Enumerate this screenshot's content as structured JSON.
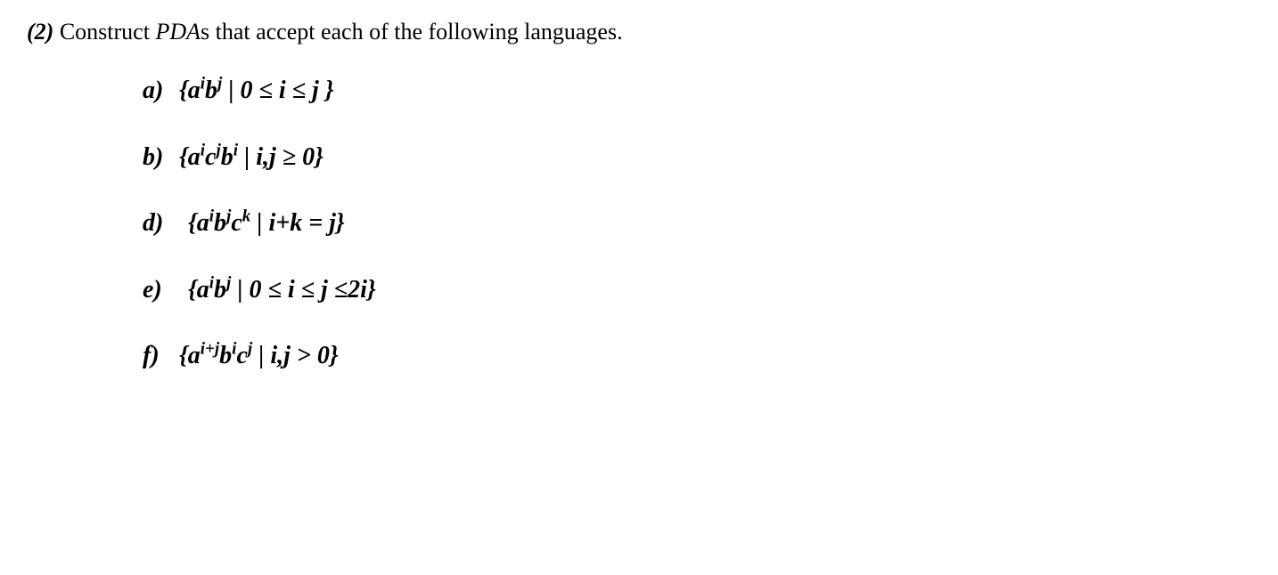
{
  "question": {
    "number": "(2)",
    "preText": " Construct ",
    "pda": "PDA",
    "postText": "s that accept each of the following languages."
  },
  "items": {
    "a": {
      "label": "a)",
      "expr_html": "{a<sup>i</sup>b<sup>j</sup> | 0 ≤ i ≤ j }"
    },
    "b": {
      "label": "b)",
      "expr_html": "{a<sup>i</sup>c<sup>j</sup>b<sup>i</sup> | i,j ≥ 0}"
    },
    "d": {
      "label": "d)",
      "expr_html": "{a<sup>i</sup>b<sup>j</sup>c<sup>k</sup> | i+k = j}"
    },
    "e": {
      "label": "e)",
      "expr_html": "{a<sup>i</sup>b<sup>j</sup> | 0 ≤ i ≤ j ≤2i}"
    },
    "f": {
      "label": "f)",
      "expr_html": "{a<sup>i+j</sup>b<sup>i</sup>c<sup>j</sup> | i,j > 0}"
    }
  }
}
